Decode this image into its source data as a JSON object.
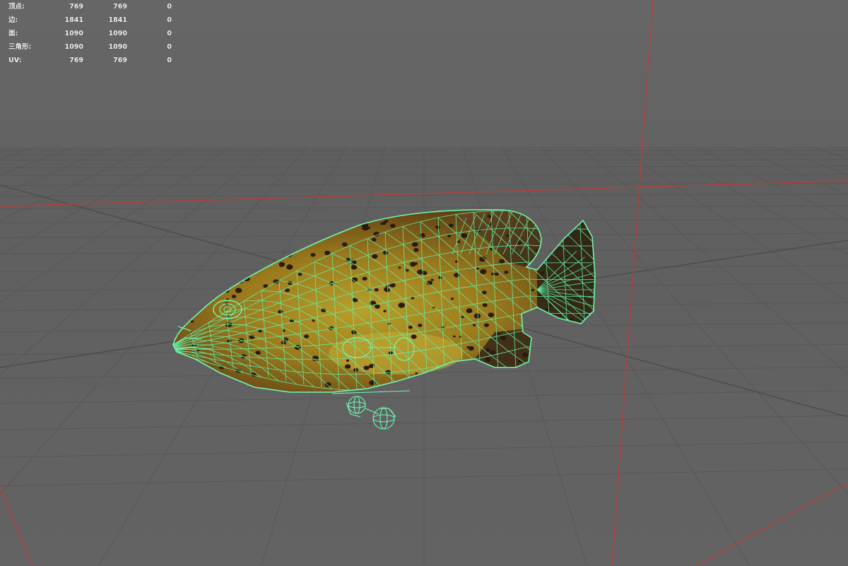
{
  "hud": {
    "rows": [
      {
        "label": "顶点:",
        "a": "769",
        "b": "769",
        "c": "0"
      },
      {
        "label": "边:",
        "a": "1841",
        "b": "1841",
        "c": "0"
      },
      {
        "label": "面:",
        "a": "1090",
        "b": "1090",
        "c": "0"
      },
      {
        "label": "三角形:",
        "a": "1090",
        "b": "1090",
        "c": "0"
      },
      {
        "label": "UV:",
        "a": "769",
        "b": "769",
        "c": "0"
      }
    ]
  },
  "colors": {
    "background": "#646464",
    "grid_line": "#555555",
    "axis_line": "#c0352f",
    "wireframe": "#5ef2a2",
    "fish_body": "#9a7a1c"
  },
  "icons": [
    "fish-mesh",
    "locator-gizmo"
  ]
}
